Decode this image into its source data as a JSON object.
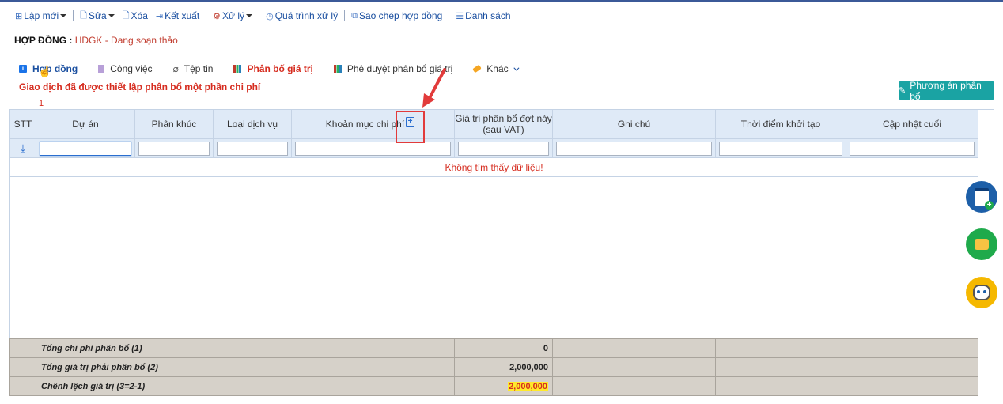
{
  "toolbar": [
    {
      "icon": "plus-square-icon",
      "label": "Lập mới",
      "dropdown": true
    },
    {
      "icon": "edit-icon",
      "label": "Sửa",
      "dropdown": true
    },
    {
      "icon": "delete-icon",
      "label": "Xóa",
      "dropdown": false
    },
    {
      "icon": "export-icon",
      "label": "Kết xuất",
      "dropdown": false
    },
    {
      "icon": "process-icon",
      "label": "Xử lý",
      "dropdown": true
    },
    {
      "icon": "history-icon",
      "label": "Quá trình xử lý",
      "dropdown": false
    },
    {
      "icon": "copy-icon",
      "label": "Sao chép hợp đồng",
      "dropdown": false
    },
    {
      "icon": "list-icon",
      "label": "Danh sách",
      "dropdown": false
    }
  ],
  "contract": {
    "label": "HỢP ĐỒNG :",
    "value": "HDGK - Đang soạn thảo"
  },
  "tabs": [
    {
      "label": "Hợp đồng",
      "icon": "info-icon"
    },
    {
      "label": "Công việc",
      "icon": "document-icon"
    },
    {
      "label": "Tệp tin",
      "icon": "paperclip-icon"
    },
    {
      "label": "Phân bố giá trị",
      "icon": "bar-chart-icon"
    },
    {
      "label": "Phê duyệt phân bổ giá trị",
      "icon": "bar-chart-icon"
    },
    {
      "label": "Khác",
      "icon": "tag-icon"
    }
  ],
  "warning": "Giao dịch đã được thiết lập phân bổ một phần chi phí",
  "annotation_number": "1",
  "plan_button": "Phương án phân bổ",
  "grid": {
    "columns": [
      "STT",
      "Dự án",
      "Phân khúc",
      "Loại dịch vụ",
      "Khoản mục chi phí",
      "Giá trị phân bổ đợt này (sau VAT)",
      "Ghi chú",
      "Thời điểm khởi tạo",
      "Cập nhật cuối"
    ],
    "empty_message": "Không tìm thấy dữ liệu!"
  },
  "summary": [
    {
      "label": "Tổng chi phí phân bổ (1)",
      "value": "0",
      "highlight": false
    },
    {
      "label": "Tổng giá trị phải phân bổ (2)",
      "value": "2,000,000",
      "highlight": false
    },
    {
      "label": "Chênh lệch giá trị (3=2-1)",
      "value": "2,000,000",
      "highlight": true
    }
  ],
  "colors": {
    "accent_blue": "#1a4fa0",
    "warning_red": "#d62d20",
    "teal_button": "#1aa3a3",
    "header_bg": "#dfeaf7",
    "summary_bg": "#d6d1c9",
    "highlight_yellow": "#ffea2a"
  }
}
